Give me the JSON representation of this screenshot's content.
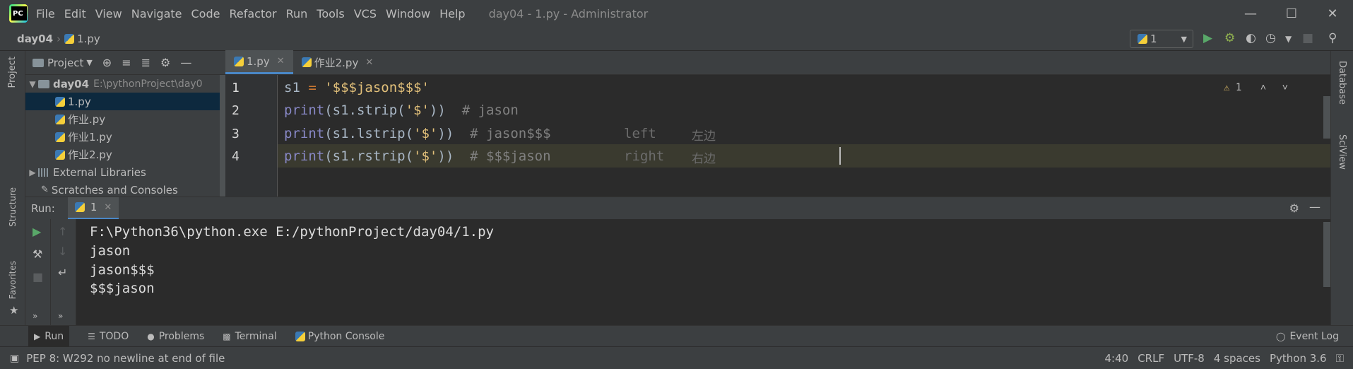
{
  "window": {
    "menu": [
      "File",
      "Edit",
      "View",
      "Navigate",
      "Code",
      "Refactor",
      "Run",
      "Tools",
      "VCS",
      "Window",
      "Help"
    ],
    "title": "day04 - 1.py - Administrator"
  },
  "navbar": {
    "project": "day04",
    "file": "1.py",
    "run_config": "1"
  },
  "project_panel": {
    "title": "Project",
    "tree": [
      {
        "label": "day04",
        "path": "E:\\pythonProject\\day0"
      },
      {
        "label": "1.py"
      },
      {
        "label": "作业.py"
      },
      {
        "label": "作业1.py"
      },
      {
        "label": "作业2.py"
      },
      {
        "label": "External Libraries"
      },
      {
        "label": "Scratches and Consoles"
      }
    ]
  },
  "left_strip": {
    "project": "Project",
    "structure": "Structure",
    "favorites": "Favorites"
  },
  "right_strip": {
    "database": "Database",
    "sciview": "SciView"
  },
  "editor": {
    "tabs": [
      {
        "label": "1.py"
      },
      {
        "label": "作业2.py"
      }
    ],
    "warnings": "1",
    "lines": [
      {
        "num": "1",
        "p1": "s1 ",
        "p2": "=",
        "p3": " '$$$jason$$$'"
      },
      {
        "num": "2",
        "fn": "print",
        "args": "(s1.strip(",
        "str": "'$'",
        "close": "))",
        "comment": "  # jason"
      },
      {
        "num": "3",
        "fn": "print",
        "args": "(s1.lstrip(",
        "str": "'$'",
        "close": "))",
        "comment": "  # jason$$$",
        "note_en": "left",
        "note_cn": "左边"
      },
      {
        "num": "4",
        "fn": "print",
        "args": "(s1.rstrip(",
        "str": "'$'",
        "close": "))",
        "comment": "  # $$$jason",
        "note_en": "right",
        "note_cn": "右边"
      }
    ]
  },
  "run": {
    "label": "Run:",
    "tab": "1",
    "output": [
      "F:\\Python36\\python.exe E:/pythonProject/day04/1.py",
      "jason",
      "jason$$$",
      "$$$jason"
    ]
  },
  "tool_tabs": {
    "run": "Run",
    "todo": "TODO",
    "problems": "Problems",
    "terminal": "Terminal",
    "python_console": "Python Console",
    "event_log": "Event Log"
  },
  "status": {
    "message": "PEP 8: W292 no newline at end of file",
    "position": "4:40",
    "line_sep": "CRLF",
    "encoding": "UTF-8",
    "indent": "4 spaces",
    "interpreter": "Python 3.6"
  }
}
